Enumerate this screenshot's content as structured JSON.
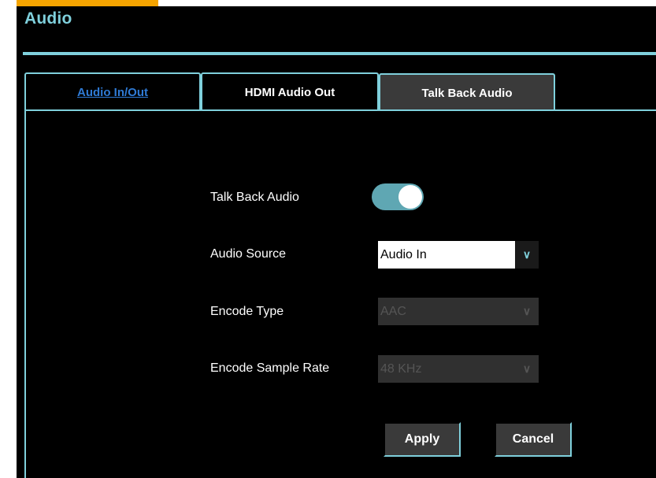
{
  "page": {
    "title": "Audio"
  },
  "tabs": [
    {
      "label": "Audio In/Out"
    },
    {
      "label": "HDMI Audio Out"
    },
    {
      "label": "Talk Back Audio"
    }
  ],
  "form": {
    "talk_back": {
      "label": "Talk Back Audio",
      "enabled": true
    },
    "audio_source": {
      "label": "Audio Source",
      "value": "Audio In"
    },
    "encode_type": {
      "label": "Encode Type",
      "value": "AAC"
    },
    "encode_sample_rate": {
      "label": "Encode Sample Rate",
      "value": "48 KHz"
    }
  },
  "buttons": {
    "apply": "Apply",
    "cancel": "Cancel"
  },
  "colors": {
    "accent": "#7fd0dc",
    "brand_bar": "#f5a400",
    "link": "#2f7bd6",
    "toggle_on": "#5fa7b3"
  },
  "icons": {
    "dropdown": "chevron-down-icon"
  }
}
